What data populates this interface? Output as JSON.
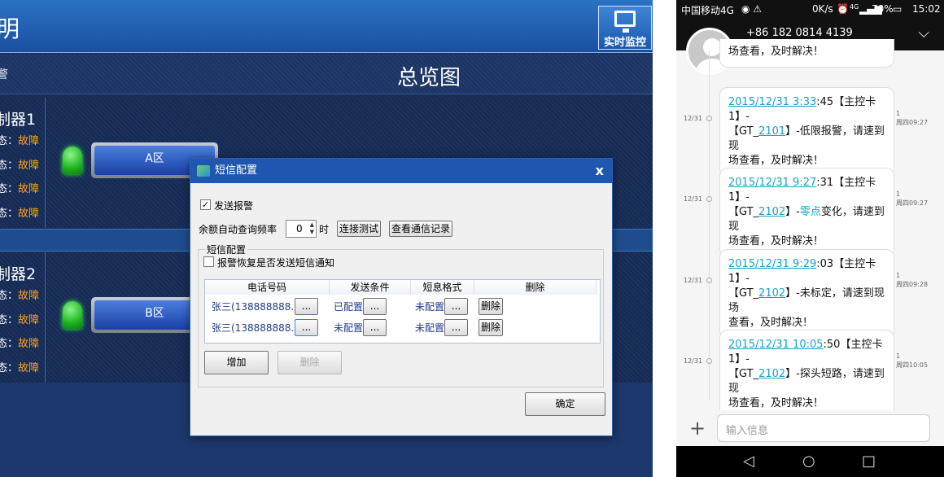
{
  "left": {
    "app_title": "明",
    "monitor_label": "实时监控",
    "subbar_text": "警",
    "overview_title": "总览图",
    "controllers": [
      {
        "title": "制器1",
        "zone": "A区",
        "status_label": "态：",
        "status_value": "故障"
      },
      {
        "title": "制器2",
        "zone": "B区",
        "status_label": "态：",
        "status_value": "故障"
      }
    ]
  },
  "dialog": {
    "title": "短信配置",
    "close": "x",
    "send_alarm_label": "发送报警",
    "freq_label": "余额自动查询频率",
    "freq_value": "0",
    "freq_unit": "时",
    "connect_test": "连接测试",
    "view_records": "查看通信记录",
    "group_title": "短信配置",
    "recover_notify_label": "报警恢复是否发送短信通知",
    "columns": [
      "电话号码",
      "发送条件",
      "短息格式",
      "删除"
    ],
    "rows": [
      {
        "phone": "张三(138888888...",
        "cond": "已配置",
        "fmt": "未配置",
        "del": "删除"
      },
      {
        "phone": "张三(138888888...",
        "cond": "未配置",
        "fmt": "未配置",
        "del": "删除"
      }
    ],
    "ellipsis": "...",
    "add_button": "增加",
    "delete_button": "删除",
    "ok_button": "确定"
  },
  "phone": {
    "carrier": "中国移动4G",
    "speed": "0K/s",
    "network": "4G",
    "battery": "70%",
    "time": "15:02",
    "contact": "+86 182 0814 4139",
    "top_partial": "场查看，及时解决！",
    "messages": [
      {
        "date": "12/31",
        "ts_link": "2015/12/31 3:33",
        "ts_rest": ":45【主控卡1】-",
        "line2a": "【GT_",
        "line2link": "2101",
        "line2b": "】-低限报警，请速到现",
        "line3": "场查看，及时解决！",
        "hl": "",
        "tag": "1",
        "time": "周四09:27"
      },
      {
        "date": "12/31",
        "ts_link": "2015/12/31 9:27",
        "ts_rest": ":31【主控卡1】-",
        "line2a": "【GT_",
        "line2link": "2102",
        "line2b": "】-",
        "hl": "零点",
        "line2c": "变化，请速到现",
        "line3": "场查看，及时解决！",
        "tag": "1",
        "time": "周四09:27"
      },
      {
        "date": "12/31",
        "ts_link": "2015/12/31 9:29",
        "ts_rest": ":03【主控卡1】-",
        "line2a": "【GT_",
        "line2link": "2102",
        "line2b": "】-未标定，请速到现场",
        "line3": "查看，及时解决！",
        "hl": "",
        "tag": "1",
        "time": "周四09:28"
      },
      {
        "date": "12/31",
        "ts_link": "2015/12/31 10:05",
        "ts_rest": ":50【主控卡1】-",
        "line2a": "【GT_",
        "line2link": "2102",
        "line2b": "】-探头短路，请速到现",
        "line3": "场查看，及时解决！",
        "hl": "",
        "tag": "1",
        "time": "周四10:05"
      }
    ],
    "input_placeholder": "输入信息",
    "add_icon": "+"
  }
}
